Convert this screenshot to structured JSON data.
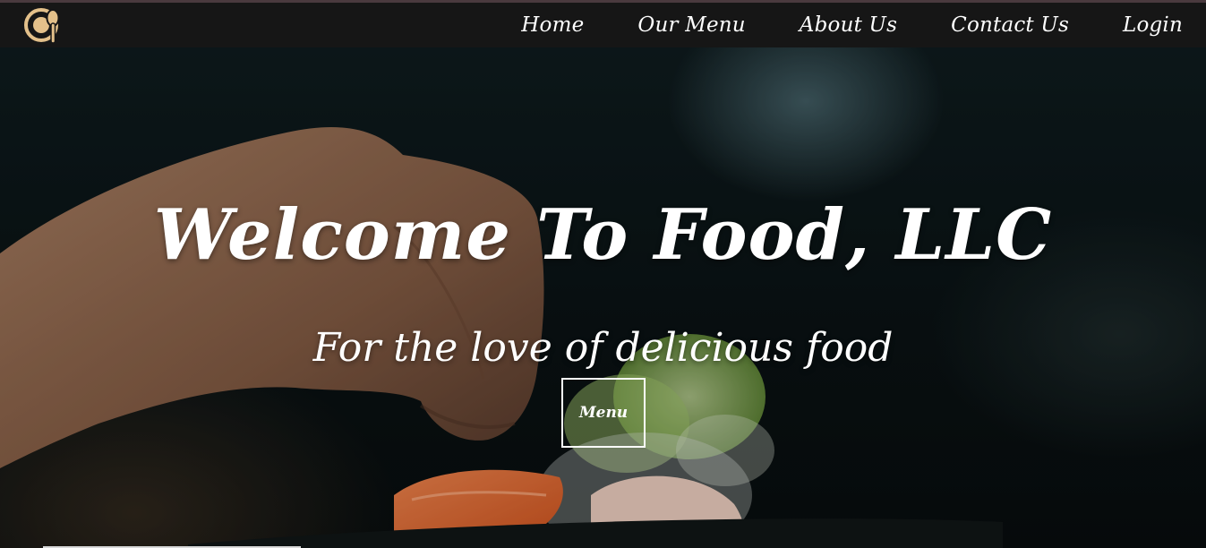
{
  "brand": {
    "logo_icon": "plate-spoon-icon",
    "accent_color": "#e3c08a"
  },
  "nav": {
    "items": [
      {
        "label": "Home"
      },
      {
        "label": "Our Menu"
      },
      {
        "label": "About Us"
      },
      {
        "label": "Contact Us"
      },
      {
        "label": "Login"
      }
    ]
  },
  "hero": {
    "title": "Welcome To Food, LLC",
    "subtitle": "For the love of delicious food",
    "button_label": "Menu"
  }
}
